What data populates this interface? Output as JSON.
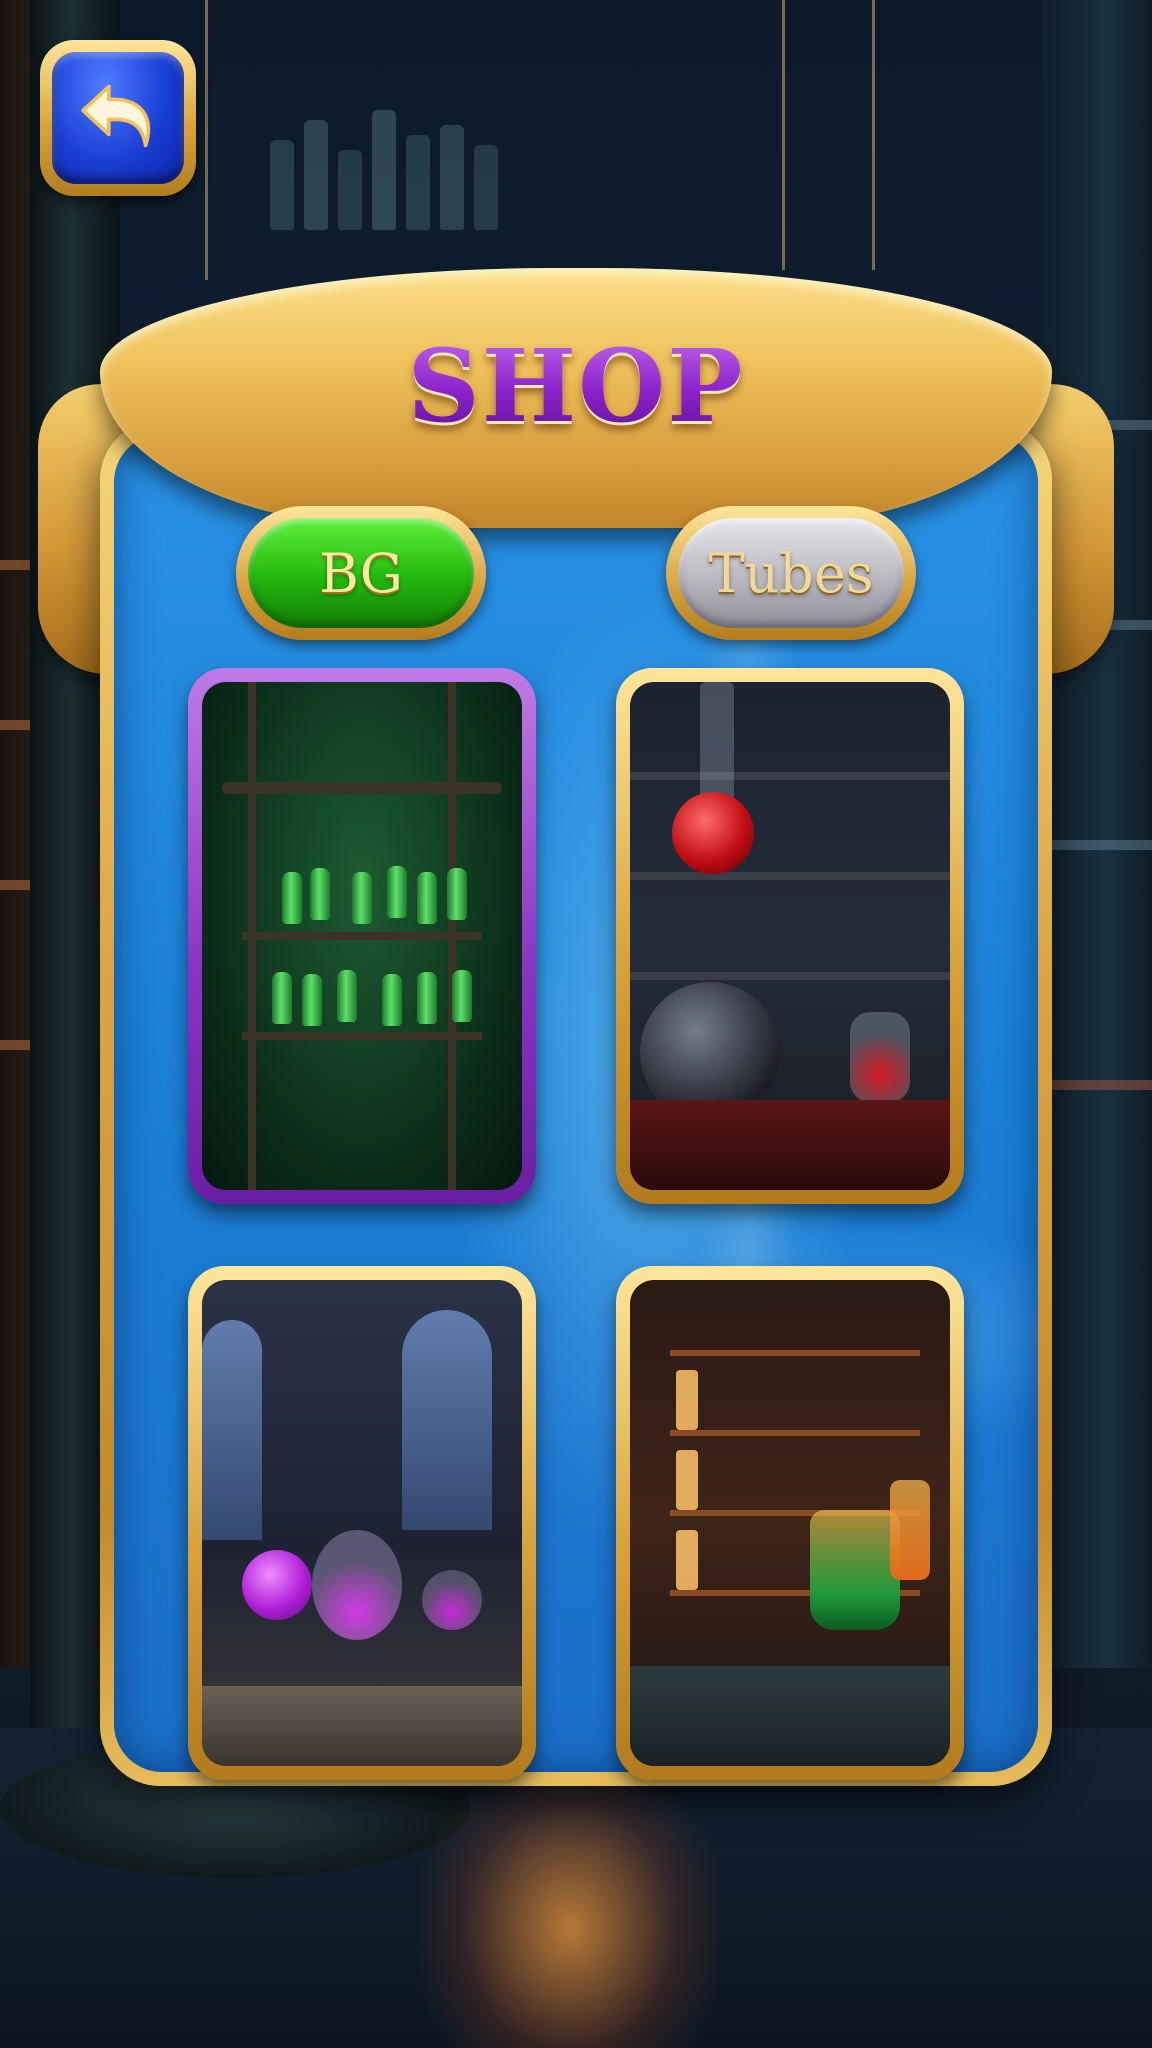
{
  "shop": {
    "title": "SHOP",
    "tabs": [
      {
        "label": "BG",
        "state": "active",
        "color": "#23b80e"
      },
      {
        "label": "Tubes",
        "state": "inactive",
        "color": "#b9b8bf"
      }
    ],
    "items": [
      {
        "theme": "green-potion-shelf",
        "selected": true
      },
      {
        "theme": "red-flask-lab",
        "selected": false
      },
      {
        "theme": "purple-flask-lab",
        "selected": false
      },
      {
        "theme": "orange-lit-lab",
        "selected": false
      }
    ]
  },
  "icons": {
    "back": "back-arrow-icon"
  },
  "colors": {
    "frame_gold": "#d8a13a",
    "panel_blue": "#1b7fd6",
    "selected_border": "#8a36c4",
    "title_purple": "#8a22c9"
  }
}
